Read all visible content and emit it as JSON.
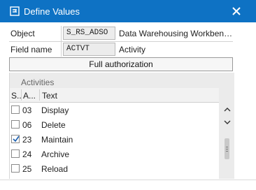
{
  "window": {
    "title": "Define Values",
    "title_bar_color": "#0e72c4"
  },
  "fields": {
    "object_label": "Object",
    "object_value": "S_RS_ADSO",
    "object_description": "Data Warehousing Workben…",
    "field_name_label": "Field name",
    "field_name_value": "ACTVT",
    "field_name_description": "Activity"
  },
  "full_authorization_label": "Full authorization",
  "panel": {
    "title": "Activities",
    "columns": [
      "S..",
      "A...",
      "Text"
    ],
    "rows": [
      {
        "code": "03",
        "text": "Display",
        "checked": false
      },
      {
        "code": "06",
        "text": "Delete",
        "checked": false
      },
      {
        "code": "23",
        "text": "Maintain",
        "checked": true
      },
      {
        "code": "24",
        "text": "Archive",
        "checked": false
      },
      {
        "code": "25",
        "text": "Reload",
        "checked": false
      }
    ]
  },
  "icons": {
    "title": "define-values-icon",
    "close": "close-icon",
    "scroll_up": "chevron-up-icon",
    "scroll_down": "chevron-down-icon",
    "checkmark": "checkmark-icon"
  }
}
